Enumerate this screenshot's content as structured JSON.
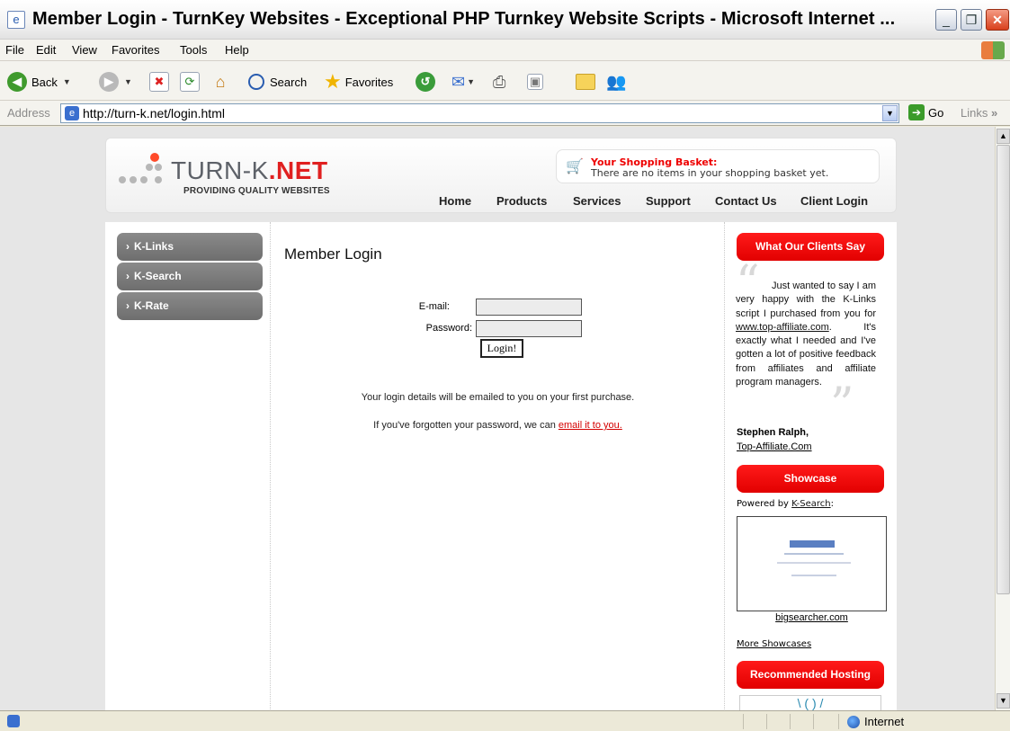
{
  "window": {
    "title": "Member Login - TurnKey Websites - Exceptional PHP Turnkey Website Scripts - Microsoft Internet ..."
  },
  "menu": [
    "File",
    "Edit",
    "View",
    "Favorites",
    "Tools",
    "Help"
  ],
  "toolbar": {
    "back_label": "Back",
    "search_label": "Search",
    "favorites_label": "Favorites"
  },
  "address": {
    "label": "Address",
    "url": "http://turn-k.net/login.html",
    "go_label": "Go",
    "links_label": "Links"
  },
  "site": {
    "logo_main": "TURN-K",
    "logo_dot": ".NET",
    "logo_tagline": "PROVIDING QUALITY WEBSITES",
    "basket_title": "Your Shopping Basket:",
    "basket_message": "There are no items in your shopping basket yet.",
    "nav": [
      "Home",
      "Products",
      "Services",
      "Support",
      "Contact Us",
      "Client Login"
    ]
  },
  "sidebar": {
    "items": [
      "K-Links",
      "K-Search",
      "K-Rate"
    ]
  },
  "login": {
    "title": "Member Login",
    "email_label": "E-mail:",
    "email_value": "",
    "password_label": "Password:",
    "password_value": "",
    "submit_label": "Login!",
    "info_line": "Your login details will be emailed to you on your first purchase.",
    "forgot_prefix": "If you've forgotten your password, we can ",
    "forgot_link": "email it to you."
  },
  "right": {
    "testimonial_header": "What Our Clients Say",
    "quote_part1": "Just wanted to say I am very happy with the K-Links script I purchased from you for ",
    "quote_link": "www.top-affiliate.com",
    "quote_part2": ". It's exactly what I needed and I've gotten a lot of positive feedback from affiliates and affiliate program managers.",
    "author": "Stephen Ralph,",
    "author_site": "Top-Affiliate.Com",
    "showcase_header": "Showcase",
    "powered_prefix": "Powered by ",
    "powered_link": "K-Search",
    "powered_suffix": ":",
    "showcase_caption": "bigsearcher.com",
    "more_showcases": "More Showcases",
    "hosting_header": "Recommended Hosting"
  },
  "status": {
    "zone": "Internet"
  },
  "colors": {
    "brand_red": "#e20000",
    "sidebar_gray": "#7a7a7a",
    "link_red": "#d40000"
  }
}
